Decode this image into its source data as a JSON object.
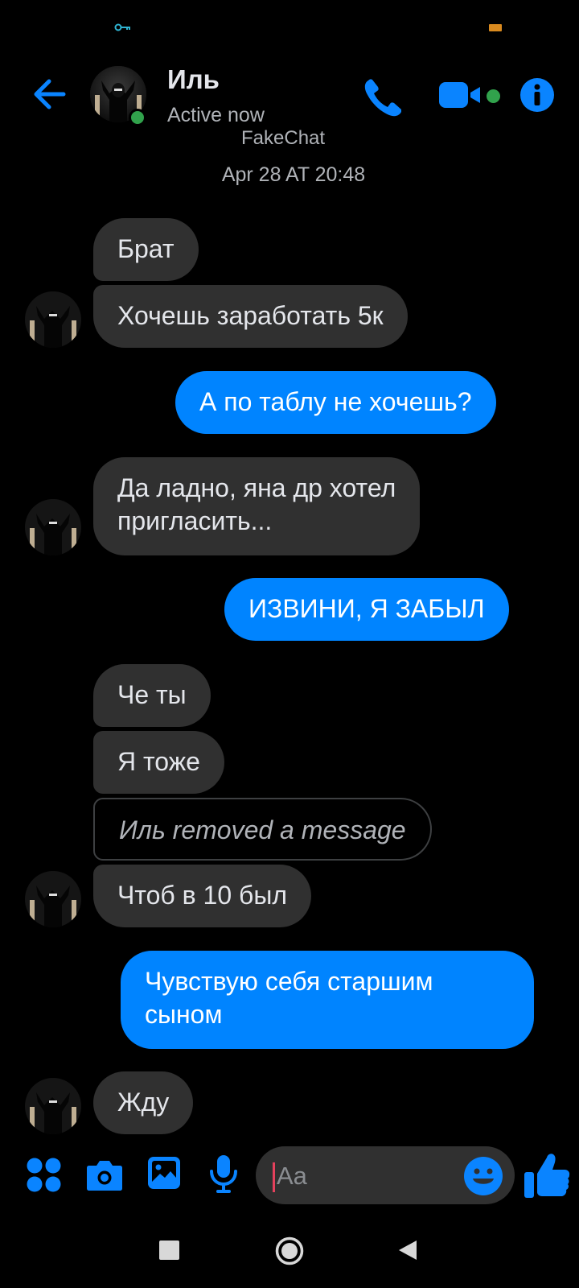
{
  "header": {
    "contact_name": "Иль",
    "contact_status": "Active now",
    "watermark": "FakeChat"
  },
  "conversation": {
    "timestamp": "Apr 28 AT 20:48",
    "messages": [
      {
        "sender": "them",
        "text": "Брат"
      },
      {
        "sender": "them",
        "text": "Хочешь заработать 5к"
      },
      {
        "sender": "me",
        "text": "А по таблу не хочешь?"
      },
      {
        "sender": "them",
        "lines": [
          "Да ладно, яна др хотел",
          "пригласить..."
        ]
      },
      {
        "sender": "me",
        "text": "ИЗВИНИ, Я ЗАБЫЛ"
      },
      {
        "sender": "them",
        "text": "Че ты"
      },
      {
        "sender": "them",
        "text": "Я тоже"
      },
      {
        "sender": "them",
        "removed": true,
        "text": "Иль removed a message"
      },
      {
        "sender": "them",
        "text": "Чтоб в 10 был"
      },
      {
        "sender": "me",
        "lines": [
          "Чувствую себя старшим",
          "сыном"
        ]
      },
      {
        "sender": "them",
        "text": "Жду"
      }
    ]
  },
  "composer": {
    "placeholder": "Aa",
    "icons": [
      "menu-grid-icon",
      "camera-icon",
      "gallery-icon",
      "microphone-icon",
      "emoji-icon",
      "like-icon"
    ]
  },
  "colors": {
    "background": "#000000",
    "incoming_bubble": "#303030",
    "outgoing_bubble": "#0084ff",
    "accent": "#0084ff",
    "online": "#31a24c"
  }
}
